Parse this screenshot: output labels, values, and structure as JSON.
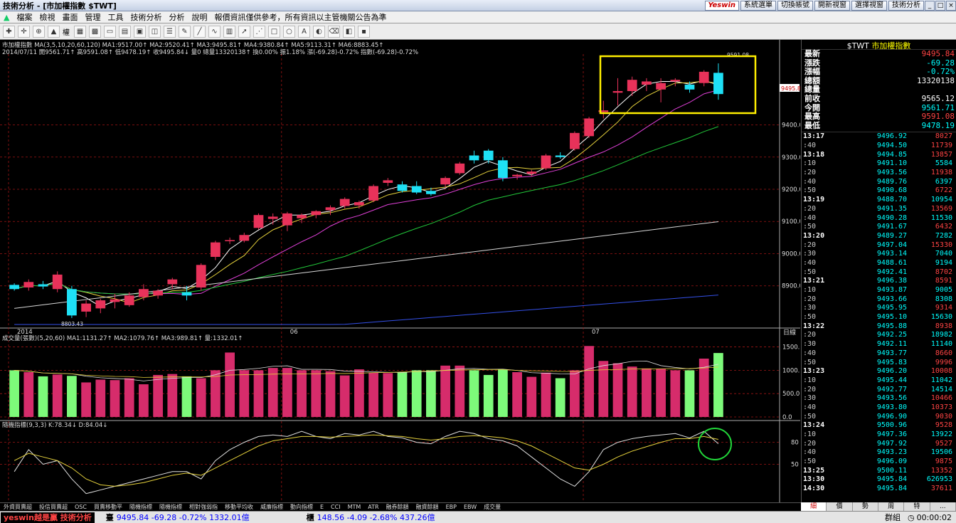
{
  "app": {
    "title": "技術分析 - [市加權指數 $TWT]",
    "yeswin": "Yeswin",
    "buttons": [
      "系統選單",
      "切換帳號",
      "開新視窗",
      "選擇視窗",
      "技術分析"
    ]
  },
  "menu": [
    "檔案",
    "檢視",
    "畫面",
    "管理",
    "工具",
    "技術分析",
    "分析",
    "說明",
    "報價資訊僅供參考，所有資訊以主管機關公告為準"
  ],
  "toolbar": {
    "rights_label": "權"
  },
  "chart_info": {
    "line1": "市加權指數 MA(3,5,10,20,60,120) MA1:9517.00↑ MA2:9520.41↑ MA3:9495.81↑ MA4:9380.84↑ MA5:9113.31↑ MA6:8883.45↑",
    "line2": "2014/07/11 開9561.71↑ 高9591.08↑ 低9478.19↑ 收9495.84↓ 量0 總量13320138↑ 換0.00% 振1.18% 漲(-69.28)-0.72% 指數(-69.28)-0.72%",
    "vol_title": "成交量(張數)(5,20,60) MA1:1131.27↑ MA2:1079.76↑ MA3:989.81↑ 量:1332.01↑",
    "kd_title": "隨機指標(9,3,3) K:78.34↓ D:84.04↓",
    "price_ticks": [
      "9400.0",
      "9300.0",
      "9200.0",
      "9100.0",
      "9000.0",
      "8900.0"
    ],
    "vol_ticks": [
      "1500.0",
      "1000.0",
      "500.0",
      "0.0"
    ],
    "kd_ticks": [
      "80",
      "50"
    ],
    "date_labels": [
      "2014",
      "06",
      "07"
    ],
    "axis_unit": "日線",
    "high_label": "9591.08",
    "low_label": "8803.43",
    "last_label": "9495.8"
  },
  "quote": {
    "code": "$TWT",
    "name": "市加權指數",
    "rows": [
      {
        "label": "最新",
        "value": "9495.84",
        "color": "#f44"
      },
      {
        "label": "漲跌",
        "value": "-69.28",
        "color": "#0ff"
      },
      {
        "label": "漲幅",
        "value": "-0.72%",
        "color": "#0ff"
      },
      {
        "label": "總額",
        "value": "13320138",
        "color": "#fff"
      },
      {
        "label": "總量",
        "value": "",
        "color": "#fff"
      },
      {
        "label": "前收",
        "value": "9565.12",
        "color": "#fff"
      },
      {
        "label": "今開",
        "value": "9561.71",
        "color": "#0ff"
      },
      {
        "label": "最高",
        "value": "9591.08",
        "color": "#f44"
      },
      {
        "label": "最低",
        "value": "9478.19",
        "color": "#0ff"
      }
    ]
  },
  "ticks": [
    {
      "t": "13:17",
      "p": "9496.92",
      "v": "8027",
      "b": true
    },
    {
      "t": ":40",
      "p": "9494.50",
      "v": "11739"
    },
    {
      "t": "13:18",
      "p": "9494.85",
      "v": "13857",
      "b": true
    },
    {
      "t": ":10",
      "p": "9491.10",
      "v": "5584",
      "dn": true
    },
    {
      "t": ":20",
      "p": "9493.56",
      "v": "11938"
    },
    {
      "t": ":40",
      "p": "9489.76",
      "v": "6397",
      "dn": true
    },
    {
      "t": ":50",
      "p": "9490.68",
      "v": "6722"
    },
    {
      "t": "13:19",
      "p": "9488.70",
      "v": "10954",
      "b": true,
      "dn": true
    },
    {
      "t": ":20",
      "p": "9491.35",
      "v": "13569"
    },
    {
      "t": ":40",
      "p": "9490.28",
      "v": "11530",
      "dn": true
    },
    {
      "t": ":50",
      "p": "9491.67",
      "v": "6432"
    },
    {
      "t": "13:20",
      "p": "9489.27",
      "v": "7282",
      "b": true,
      "dn": true
    },
    {
      "t": ":20",
      "p": "9497.04",
      "v": "15330"
    },
    {
      "t": ":30",
      "p": "9493.14",
      "v": "7040",
      "dn": true
    },
    {
      "t": ":40",
      "p": "9488.61",
      "v": "9194",
      "dn": true
    },
    {
      "t": ":50",
      "p": "9492.41",
      "v": "8702"
    },
    {
      "t": "13:21",
      "p": "9496.38",
      "v": "8591",
      "b": true
    },
    {
      "t": ":10",
      "p": "9493.87",
      "v": "9005",
      "dn": true
    },
    {
      "t": ":20",
      "p": "9493.66",
      "v": "8308",
      "dn": true
    },
    {
      "t": ":30",
      "p": "9495.95",
      "v": "9314"
    },
    {
      "t": ":50",
      "p": "9495.10",
      "v": "15630",
      "dn": true
    },
    {
      "t": "13:22",
      "p": "9495.88",
      "v": "8938",
      "b": true
    },
    {
      "t": ":20",
      "p": "9492.25",
      "v": "18982",
      "dn": true
    },
    {
      "t": ":30",
      "p": "9492.11",
      "v": "11140",
      "dn": true
    },
    {
      "t": ":40",
      "p": "9493.77",
      "v": "8660"
    },
    {
      "t": ":50",
      "p": "9495.83",
      "v": "9996"
    },
    {
      "t": "13:23",
      "p": "9496.20",
      "v": "10008",
      "b": true
    },
    {
      "t": ":10",
      "p": "9495.44",
      "v": "11042",
      "dn": true
    },
    {
      "t": ":20",
      "p": "9492.77",
      "v": "14514",
      "dn": true
    },
    {
      "t": ":30",
      "p": "9493.56",
      "v": "10466"
    },
    {
      "t": ":40",
      "p": "9493.80",
      "v": "10373"
    },
    {
      "t": ":50",
      "p": "9496.90",
      "v": "9030"
    },
    {
      "t": "13:24",
      "p": "9500.96",
      "v": "9528",
      "b": true
    },
    {
      "t": ":10",
      "p": "9497.36",
      "v": "13922",
      "dn": true
    },
    {
      "t": ":20",
      "p": "9497.92",
      "v": "9527"
    },
    {
      "t": ":40",
      "p": "9493.23",
      "v": "19506",
      "dn": true
    },
    {
      "t": ":50",
      "p": "9496.09",
      "v": "9875"
    },
    {
      "t": "13:25",
      "p": "9500.11",
      "v": "13352",
      "b": true
    },
    {
      "t": "13:30",
      "p": "9495.84",
      "v": "626953",
      "b": true,
      "dn": true
    },
    {
      "t": "14:30",
      "p": "9495.84",
      "v": "37611",
      "b": true
    }
  ],
  "tick_tabs": [
    "細",
    "價",
    "勢",
    "周",
    "特",
    "..."
  ],
  "indicator_tabs": [
    "外資買賣超",
    "投信買賣超",
    "OSC",
    "買賣移動平",
    "隨機指標",
    "隨機指標",
    "相對強弱指",
    "移動平均收",
    "威廉指標",
    "動向指標",
    "E",
    "CCI",
    "MTM",
    "ATR",
    "融券餘額",
    "融資餘額",
    "EBP",
    "EBW",
    "成交量"
  ],
  "status": {
    "brand": "yeswin越是贏 技術分析",
    "idx1_name": "臺",
    "idx1": "9495.84 -69.28 -0.72% 1332.01億",
    "idx2_name": "櫃",
    "idx2": "148.56 -4.09 -2.68% 437.26億",
    "clock": "00:00:02",
    "mode": "群組"
  },
  "colors": {
    "up": "#e8325a",
    "down": "#1ee0f5",
    "vol_up": "#d62c6b",
    "vol_down": "#7dfa7a",
    "ma1": "#ffffff",
    "ma2": "#e6d23c",
    "ma3": "#e040d8",
    "ma4": "#22c83a",
    "ma5": "#d8d8d8",
    "ma6": "#3450e8"
  },
  "chart_data": [
    {
      "type": "candlestick",
      "title": "市加權指數",
      "ylim": [
        8780,
        9620
      ],
      "x_labels": [
        "2014",
        "06",
        "07"
      ],
      "candles": [
        [
          8903,
          8908,
          8885,
          8890
        ],
        [
          8895,
          8920,
          8885,
          8912
        ],
        [
          8905,
          8915,
          8890,
          8898
        ],
        [
          8890,
          8945,
          8880,
          8935
        ],
        [
          8890,
          8900,
          8800,
          8808
        ],
        [
          8820,
          8855,
          8803,
          8845
        ],
        [
          8830,
          8860,
          8815,
          8855
        ],
        [
          8850,
          8875,
          8830,
          8858
        ],
        [
          8840,
          8880,
          8835,
          8870
        ],
        [
          8865,
          8905,
          8855,
          8890
        ],
        [
          8870,
          8890,
          8860,
          8885
        ],
        [
          8905,
          8925,
          8890,
          8920
        ],
        [
          8880,
          8900,
          8855,
          8870
        ],
        [
          8895,
          8970,
          8885,
          8965
        ],
        [
          8990,
          9040,
          8980,
          9035
        ],
        [
          9040,
          9050,
          9030,
          9042
        ],
        [
          9040,
          9065,
          9035,
          9058
        ],
        [
          9080,
          9125,
          9075,
          9120
        ],
        [
          9108,
          9125,
          9090,
          9115
        ],
        [
          9088,
          9130,
          9070,
          9125
        ],
        [
          9110,
          9125,
          9095,
          9120
        ],
        [
          9120,
          9135,
          9110,
          9132
        ],
        [
          9135,
          9150,
          9120,
          9144
        ],
        [
          9148,
          9175,
          9140,
          9170
        ],
        [
          9150,
          9165,
          9140,
          9160
        ],
        [
          9165,
          9215,
          9160,
          9210
        ],
        [
          9220,
          9235,
          9210,
          9228
        ],
        [
          9215,
          9225,
          9190,
          9195
        ],
        [
          9210,
          9225,
          9185,
          9190
        ],
        [
          9195,
          9205,
          9180,
          9185
        ],
        [
          9215,
          9240,
          9205,
          9235
        ],
        [
          9250,
          9285,
          9245,
          9280
        ],
        [
          9305,
          9320,
          9280,
          9290
        ],
        [
          9320,
          9325,
          9280,
          9290
        ],
        [
          9290,
          9300,
          9225,
          9235
        ],
        [
          9240,
          9248,
          9230,
          9245
        ],
        [
          9248,
          9260,
          9240,
          9255
        ],
        [
          9265,
          9310,
          9260,
          9305
        ],
        [
          9305,
          9315,
          9295,
          9300
        ],
        [
          9325,
          9380,
          9320,
          9375
        ],
        [
          9365,
          9425,
          9360,
          9420
        ],
        [
          9440,
          9475,
          9420,
          9445
        ],
        [
          9500,
          9545,
          9460,
          9505
        ],
        [
          9505,
          9550,
          9490,
          9540
        ],
        [
          9525,
          9545,
          9505,
          9535
        ],
        [
          9510,
          9545,
          9470,
          9530
        ],
        [
          9535,
          9545,
          9520,
          9540
        ],
        [
          9525,
          9535,
          9500,
          9510
        ],
        [
          9530,
          9570,
          9520,
          9565
        ],
        [
          9561.71,
          9591.08,
          9478.19,
          9495.84
        ]
      ]
    },
    {
      "type": "bar",
      "title": "成交量(張數)(5,20,60)",
      "ylim": [
        0,
        1600
      ],
      "values": [
        1000,
        960,
        870,
        910,
        880,
        740,
        800,
        790,
        830,
        700,
        900,
        920,
        870,
        830,
        1000,
        1380,
        1000,
        1000,
        1050,
        1050,
        1000,
        1000,
        980,
        890,
        1020,
        950,
        940,
        960,
        1000,
        1000,
        1100,
        1100,
        1000,
        900,
        1020,
        960,
        860,
        950,
        830,
        1000,
        1520,
        1200,
        1150,
        1080,
        1040,
        1030,
        1000,
        1000,
        1250,
        1370
      ]
    },
    {
      "type": "line",
      "title": "隨機指標(9,3,3)",
      "ylim": [
        0,
        100
      ],
      "series": [
        {
          "name": "K",
          "values": [
            40,
            70,
            50,
            55,
            30,
            10,
            15,
            20,
            25,
            30,
            35,
            40,
            40,
            30,
            55,
            70,
            80,
            88,
            90,
            88,
            95,
            88,
            85,
            92,
            90,
            95,
            88,
            86,
            80,
            78,
            88,
            95,
            92,
            85,
            82,
            75,
            60,
            45,
            30,
            20,
            40,
            70,
            80,
            85,
            88,
            90,
            92,
            86,
            95,
            78
          ]
        },
        {
          "name": "D",
          "values": [
            55,
            65,
            60,
            55,
            45,
            30,
            22,
            20,
            22,
            25,
            30,
            35,
            38,
            35,
            45,
            55,
            65,
            75,
            82,
            85,
            88,
            88,
            87,
            88,
            89,
            90,
            89,
            88,
            85,
            83,
            85,
            88,
            89,
            88,
            86,
            82,
            75,
            65,
            55,
            45,
            42,
            50,
            60,
            68,
            74,
            80,
            85,
            85,
            88,
            84
          ]
        }
      ]
    }
  ]
}
